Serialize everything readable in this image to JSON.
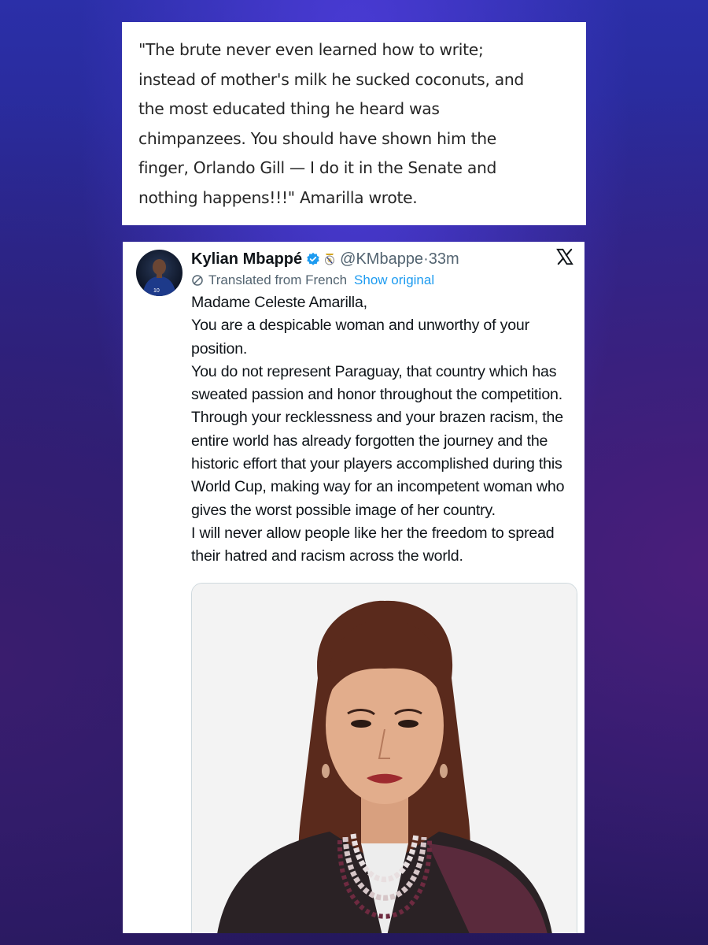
{
  "quote": {
    "lines": [
      "\"The brute never even learned how to write;",
      "instead of mother's milk he sucked coconuts, and",
      "the most educated thing he heard was",
      "chimpanzees. You should have shown him the",
      "finger, Orlando Gill — I do it in the Senate and",
      "nothing happens!!!\" Amarilla wrote."
    ]
  },
  "tweet": {
    "author_name": "Kylian Mbappé",
    "handle": "@KMbappe",
    "separator": "·",
    "time": "33m",
    "translation_label": "Translated from French",
    "show_original_label": "Show original",
    "body_lines": [
      "Madame Celeste Amarilla,",
      "You are a despicable woman and unworthy of your position.",
      "You do not represent Paraguay, that country which has sweated passion and honor throughout the competition. Through your recklessness and your brazen racism, the entire world has already forgotten the journey and the historic effort that your players accomplished during this World Cup, making way for an incompetent woman who gives the worst possible image of her country.",
      "I will never allow people like her the freedom to spread their hatred and racism across the world."
    ],
    "icons": {
      "verified": "verified-badge-icon",
      "club": "real-madrid-crest-icon",
      "platform": "x-logo-icon",
      "translate": "globe-icon"
    },
    "colors": {
      "verified": "#1d9bf0",
      "link": "#1d9bf0",
      "secondary_text": "#536471"
    }
  }
}
